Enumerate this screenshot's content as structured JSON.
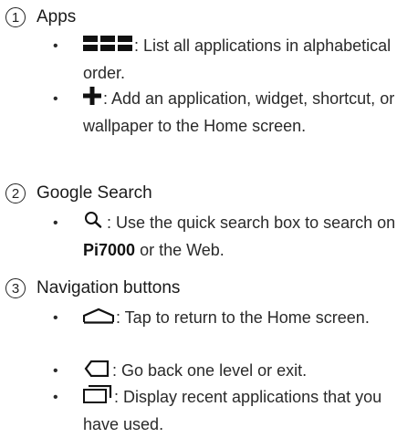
{
  "sections": [
    {
      "number": "1",
      "title": "Apps",
      "items": [
        {
          "icon": "grid-icon",
          "text": ": List all applications in alphabetical order."
        },
        {
          "icon": "plus-icon",
          "text": ": Add an application, widget, shortcut, or wallpaper to the Home screen."
        }
      ]
    },
    {
      "number": "2",
      "title": "Google Search",
      "items": [
        {
          "icon": "search-icon",
          "text_before": ": Use the quick search box to search on ",
          "bold": "Pi7000",
          "text_after": " or the Web."
        }
      ]
    },
    {
      "number": "3",
      "title": "Navigation buttons",
      "items": [
        {
          "icon": "home-icon",
          "text": ": Tap to return to the Home screen."
        },
        {
          "icon": "back-icon",
          "text": ": Go back one level or exit."
        },
        {
          "icon": "recent-apps-icon",
          "text": ": Display recent applications that you have used."
        }
      ]
    }
  ],
  "bullet": "•"
}
